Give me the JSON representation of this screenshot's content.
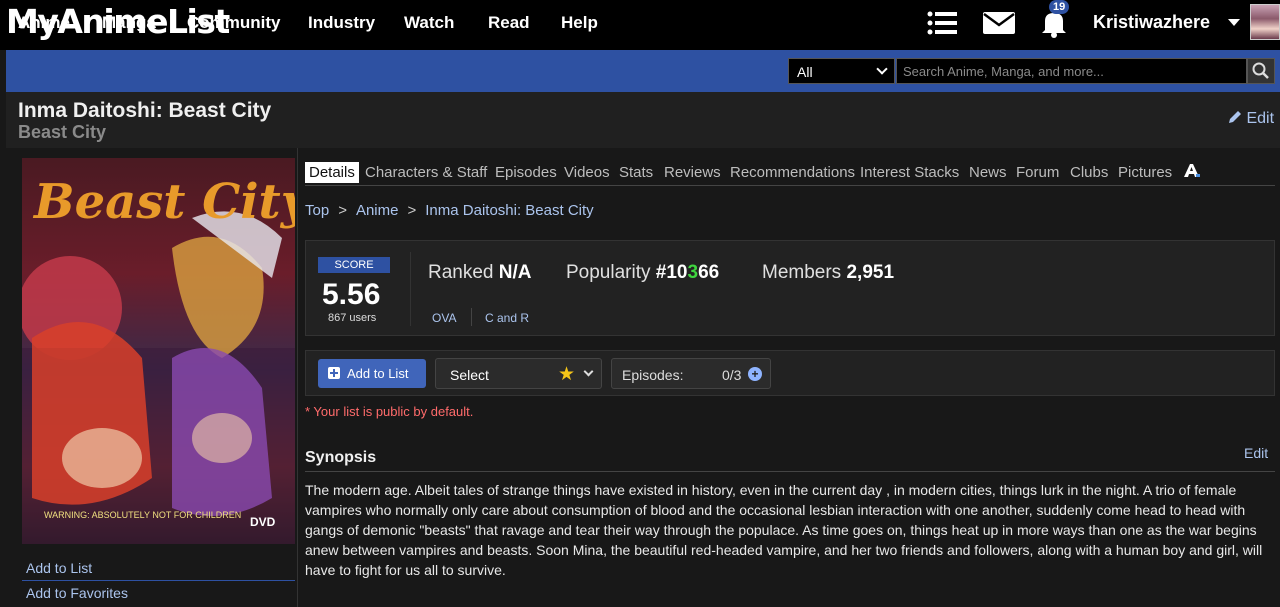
{
  "header": {
    "logo": "MyAnimeList",
    "notifications_count": "19",
    "username": "Kristiwazhere",
    "icons": [
      "menu-list-icon",
      "mail-icon",
      "bell-icon"
    ]
  },
  "nav": {
    "items": [
      "Anime",
      "Manga",
      "Community",
      "Industry",
      "Watch",
      "Read",
      "Help"
    ],
    "search_category": "All",
    "search_placeholder": "Search Anime, Manga, and more..."
  },
  "title": {
    "main": "Inma Daitoshi: Beast City",
    "alt": "Beast City",
    "edit": "Edit"
  },
  "poster": {
    "title_text": "Beast City",
    "warning_text": "WARNING: ABSOLUTELY NOT FOR CHILDREN",
    "dvd_text": "DVD"
  },
  "sidebar": {
    "links": [
      "Add to List",
      "Add to Favorites"
    ]
  },
  "tabs": [
    "Details",
    "Characters & Staff",
    "Episodes",
    "Videos",
    "Stats",
    "Reviews",
    "Recommendations",
    "Interest Stacks",
    "News",
    "Forum",
    "Clubs",
    "Pictures"
  ],
  "breadcrumb": [
    "Top",
    "Anime",
    "Inma Daitoshi: Beast City"
  ],
  "stats": {
    "score_label": "SCORE",
    "score": "5.56",
    "users": "867 users",
    "ranked_label": "Ranked",
    "ranked_value": "N/A",
    "popularity_label": "Popularity",
    "popularity_pre": "#10",
    "popularity_hl": "3",
    "popularity_post": "66",
    "members_label": "Members",
    "members_value": "2,951",
    "type": "OVA",
    "studio": "C and R"
  },
  "list": {
    "add_label": "Add to List",
    "select_label": "Select",
    "episodes_label": "Episodes:",
    "episodes_value": "0/3",
    "public_note": "* Your list is public by default."
  },
  "synopsis": {
    "title": "Synopsis",
    "edit": "Edit",
    "text": "The modern age. Albeit tales of strange things have existed in history, even in the current day , in modern cities, things lurk in the night. A trio of female vampires who normally only care about consumption of blood and the occasional lesbian interaction with one another, suddenly come head to head with gangs of demonic \"beasts\" that ravage and tear their way through the populace. As time goes on, things heat up in more ways than one as the war begins anew between vampires and beasts. Soon Mina, the beautiful red-headed vampire, and her two friends and followers, along with a human boy and girl, will have to fight for us all to survive."
  },
  "colors": {
    "brand_blue": "#2e51a2",
    "link": "#abc4ed",
    "background": "#181818",
    "warning": "#ff6b6b",
    "highlight_green": "#3fd43f"
  }
}
